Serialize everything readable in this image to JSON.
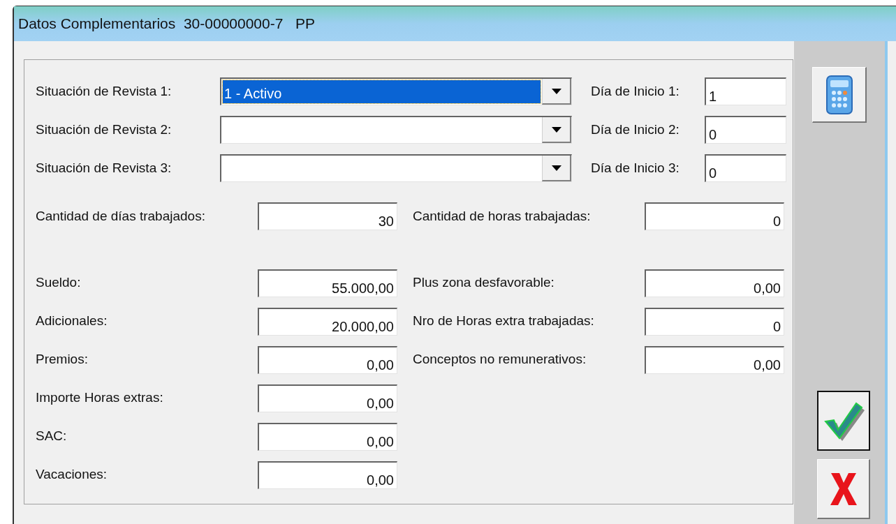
{
  "window": {
    "title": "Datos Complementarios  30-00000000-7   PP"
  },
  "situaciones": [
    {
      "label": "Situación de Revista 1:",
      "value": "1 - Activo",
      "selected": true
    },
    {
      "label": "Situación de Revista 2:",
      "selected": false
    },
    {
      "label": "Situación de Revista 3:",
      "selected": false
    }
  ],
  "dias_inicio": [
    {
      "label": "Día de Inicio 1:",
      "value": "1"
    },
    {
      "label": "Día de Inicio 2:",
      "value": "0"
    },
    {
      "label": "Día de Inicio 3:",
      "value": "0"
    }
  ],
  "cantidades": [
    {
      "label": "Cantidad de días trabajados:",
      "value": "30"
    },
    {
      "label": "Cantidad de horas trabajadas:",
      "value": "0"
    }
  ],
  "importes_izquierda": [
    {
      "label": "Sueldo:",
      "value": "55.000,00"
    },
    {
      "label": "Adicionales:",
      "value": "20.000,00"
    },
    {
      "label": "Premios:",
      "value": "0,00"
    },
    {
      "label": "Importe Horas extras:",
      "value": "0,00"
    },
    {
      "label": "SAC:",
      "value": "0,00"
    },
    {
      "label": "Vacaciones:",
      "value": "0,00"
    }
  ],
  "importes_derecha": [
    {
      "label": "Plus zona desfavorable:",
      "value": "0,00"
    },
    {
      "label": "Nro de Horas extra trabajadas:",
      "value": "0"
    },
    {
      "label": "Conceptos no remunerativos:",
      "value": "0,00"
    }
  ]
}
